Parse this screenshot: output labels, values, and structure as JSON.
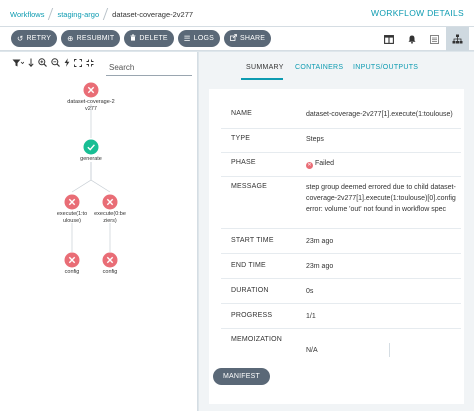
{
  "breadcrumbs": [
    "Workflows",
    "staging-argo",
    "dataset-coverage-2v277"
  ],
  "page_title": "WORKFLOW DETAILS",
  "toolbar": {
    "buttons": [
      {
        "label": "RETRY",
        "icon": "undo-icon"
      },
      {
        "label": "RESUBMIT",
        "icon": "plus-circle-icon"
      },
      {
        "label": "DELETE",
        "icon": "trash-icon"
      },
      {
        "label": "LOGS",
        "icon": "list-icon"
      },
      {
        "label": "SHARE",
        "icon": "share-icon"
      }
    ],
    "view_icons": [
      "columns-icon",
      "bell-icon",
      "event-icon",
      "sitemap-icon"
    ]
  },
  "graph": {
    "search_placeholder": "Search",
    "tools": [
      "filter-icon",
      "sort-down-icon",
      "zoom-in-icon",
      "zoom-out-icon",
      "bolt-icon",
      "expand-icon",
      "compress-icon"
    ],
    "nodes": [
      {
        "label": "dataset-coverage-2v277",
        "status": "failed"
      },
      {
        "label": "generate",
        "status": "succeeded"
      },
      {
        "label": "execute(1:toulouse)",
        "status": "failed"
      },
      {
        "label": "execute(0:beziers)",
        "status": "failed"
      },
      {
        "label": "config",
        "status": "failed"
      },
      {
        "label": "config",
        "status": "failed"
      }
    ]
  },
  "tabs": [
    "SUMMARY",
    "CONTAINERS",
    "INPUTS/OUTPUTS"
  ],
  "summary": {
    "name": {
      "label": "NAME",
      "value": "dataset-coverage-2v277[1].execute(1:toulouse)"
    },
    "type": {
      "label": "TYPE",
      "value": "Steps"
    },
    "phase": {
      "label": "PHASE",
      "value": "Failed"
    },
    "message": {
      "label": "MESSAGE",
      "value": "step group deemed errored due to child dataset-coverage-2v277[1].execute(1:toulouse)[0].config error: volume 'out' not found in workflow spec"
    },
    "start_time": {
      "label": "START TIME",
      "value": "23m ago"
    },
    "end_time": {
      "label": "END TIME",
      "value": "23m ago"
    },
    "duration": {
      "label": "DURATION",
      "value": "0s"
    },
    "progress": {
      "label": "PROGRESS",
      "value": "1/1"
    },
    "memoization": {
      "label": "MEMOIZATION",
      "value": "N/A"
    }
  },
  "manifest_button": "MANIFEST",
  "colors": {
    "accent": "#0d9bb1",
    "failed": "#e96d76",
    "succeeded": "#18be94",
    "button": "#5a6877"
  }
}
